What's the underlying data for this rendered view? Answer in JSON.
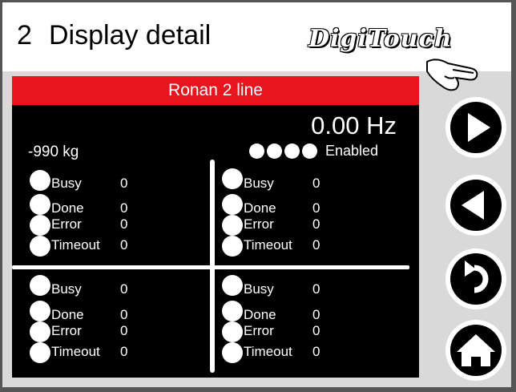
{
  "header": {
    "page_number": "2",
    "title": "Display detail",
    "logo_text": "DigiTouch"
  },
  "device": {
    "name": "Ronan 2 line",
    "frequency": "0.00 Hz",
    "weight": "-990 kg",
    "status_label": "Enabled"
  },
  "quadrants": [
    {
      "rows": [
        {
          "label": "Busy",
          "value": "0"
        },
        {
          "label": "Done",
          "value": "0"
        },
        {
          "label": "Error",
          "value": "0"
        },
        {
          "label": "Timeout",
          "value": "0"
        }
      ]
    },
    {
      "rows": [
        {
          "label": "Busy",
          "value": "0"
        },
        {
          "label": "Done",
          "value": "0"
        },
        {
          "label": "Error",
          "value": "0"
        },
        {
          "label": "Timeout",
          "value": "0"
        }
      ]
    },
    {
      "rows": [
        {
          "label": "Busy",
          "value": "0"
        },
        {
          "label": "Done",
          "value": "0"
        },
        {
          "label": "Error",
          "value": "0"
        },
        {
          "label": "Timeout",
          "value": "0"
        }
      ]
    },
    {
      "rows": [
        {
          "label": "Busy",
          "value": "0"
        },
        {
          "label": "Done",
          "value": "0"
        },
        {
          "label": "Error",
          "value": "0"
        },
        {
          "label": "Timeout",
          "value": "0"
        }
      ]
    }
  ],
  "nav": {
    "buttons": [
      {
        "icon": "play-forward-icon"
      },
      {
        "icon": "play-back-icon"
      },
      {
        "icon": "undo-icon"
      },
      {
        "icon": "home-icon"
      }
    ]
  },
  "colors": {
    "accent_red": "#e8141e",
    "screen_bg": "#000000",
    "panel_bg": "#d9d9d9"
  }
}
